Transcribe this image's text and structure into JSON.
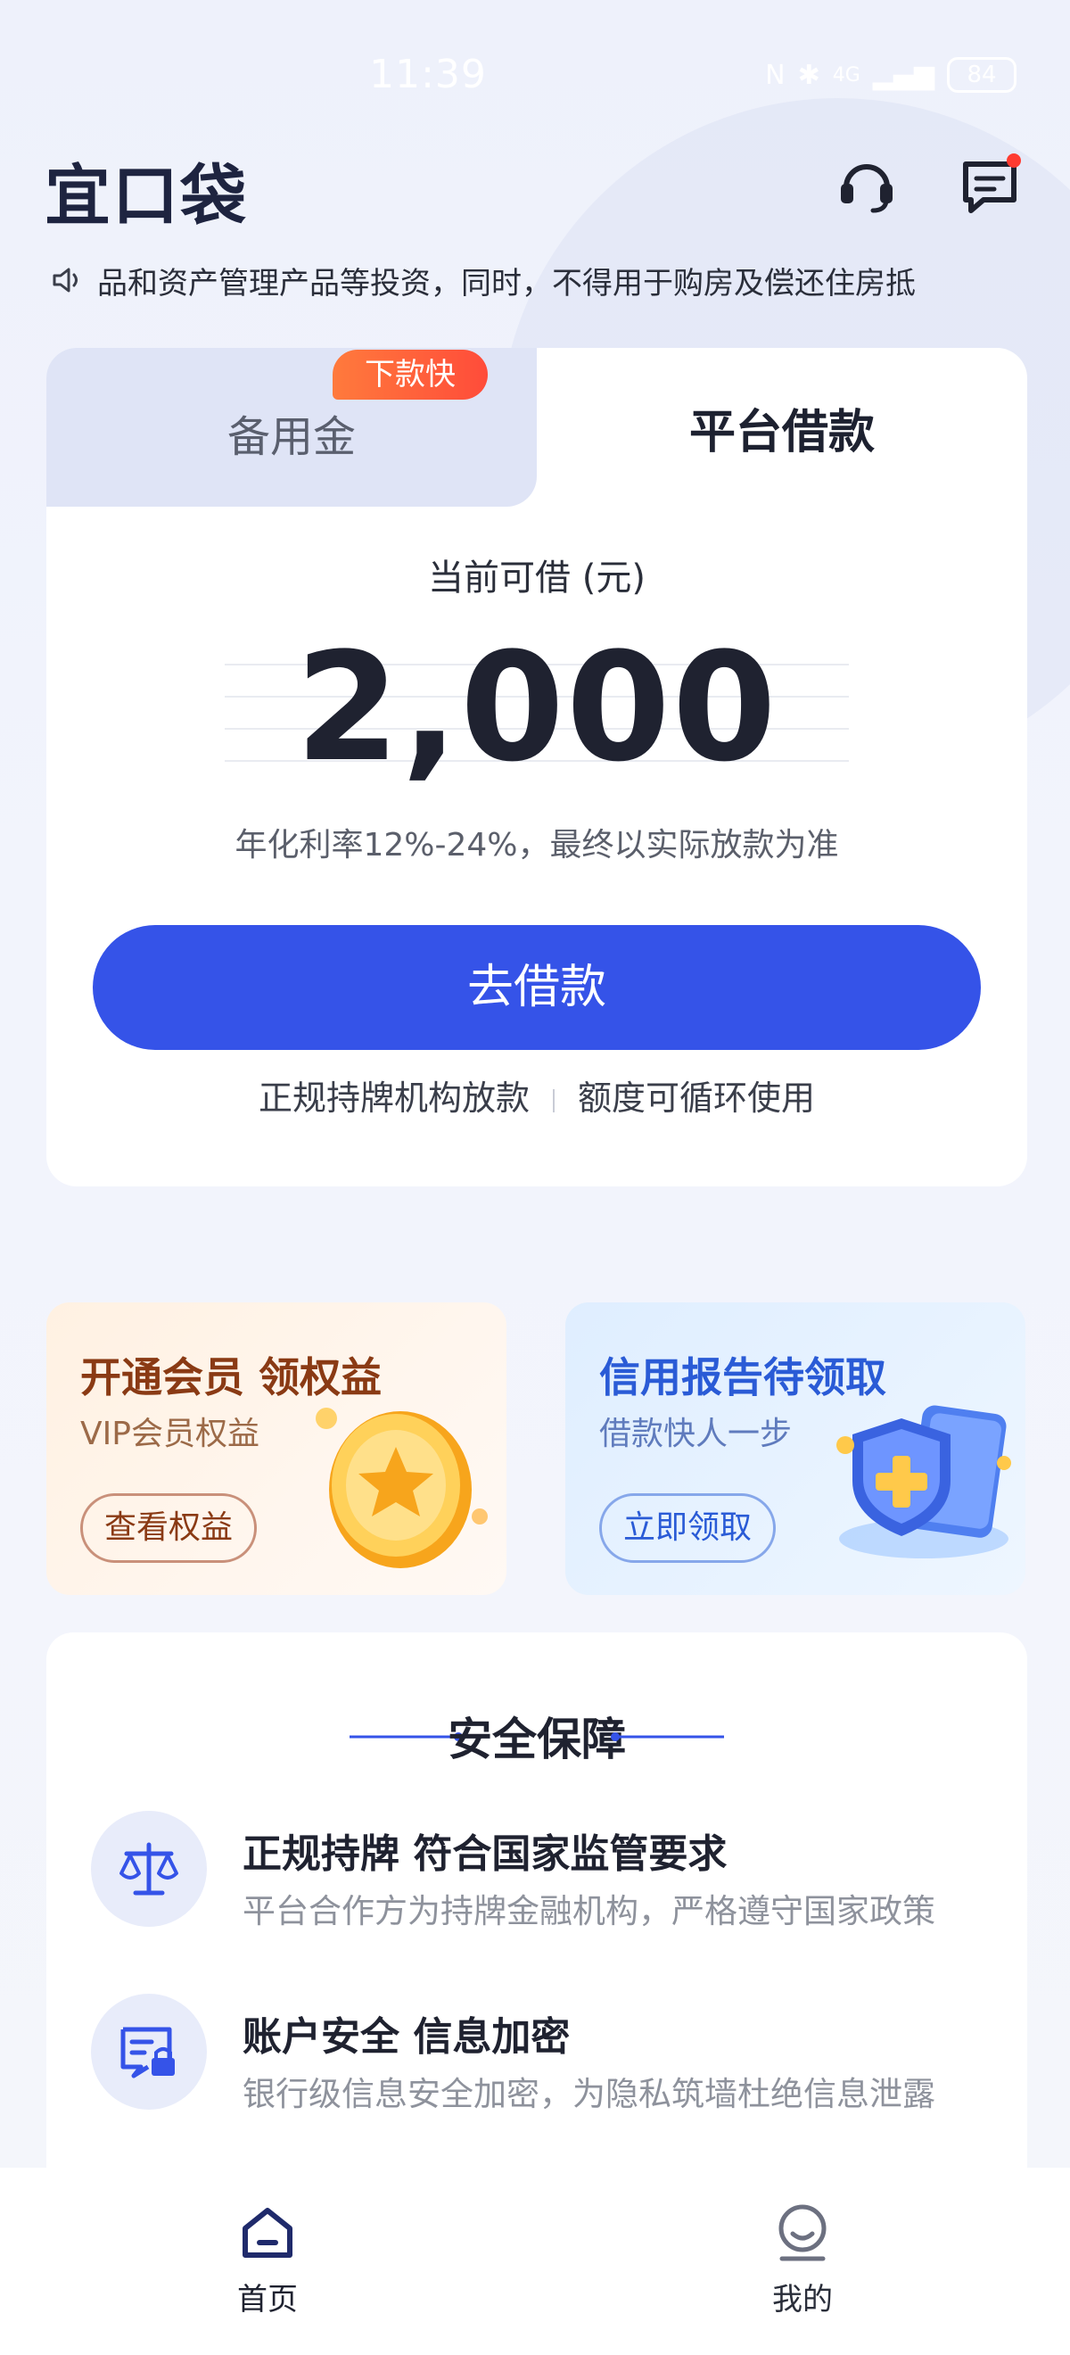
{
  "status_bar": {
    "time": "11:39",
    "network": "4G",
    "battery": "84"
  },
  "header": {
    "logo": "宜口袋",
    "support_icon": "headset-icon",
    "message_icon": "message-icon"
  },
  "notice": {
    "icon": "speaker-icon",
    "text": "品和资产管理产品等投资，同时，不得用于购房及偿还住房抵"
  },
  "loan_card": {
    "tabs": [
      {
        "label": "备用金",
        "badge": "下款快",
        "active": false
      },
      {
        "label": "平台借款",
        "active": true
      }
    ],
    "available_label": "当前可借 (元)",
    "amount": "2,000",
    "rate_note": "年化利率12%-24%，最终以实际放款为准",
    "button_label": "去借款",
    "features": [
      "正规持牌机构放款",
      "额度可循环使用"
    ]
  },
  "promos": [
    {
      "title": "开通会员  领权益",
      "subtitle": "VIP会员权益",
      "button": "查看权益",
      "icon": "star-coin-icon"
    },
    {
      "title": "信用报告待领取",
      "subtitle": "借款快人一步",
      "button": "立即领取",
      "icon": "shield-icon"
    }
  ],
  "security": {
    "title": "安全保障",
    "items": [
      {
        "icon": "scale-icon",
        "title": "正规持牌  符合国家监管要求",
        "desc": "平台合作方为持牌金融机构，严格遵守国家政策"
      },
      {
        "icon": "id-card-lock-icon",
        "title": "账户安全  信息加密",
        "desc": "银行级信息安全加密，为隐私筑墙杜绝信息泄露"
      }
    ]
  },
  "bottom_nav": [
    {
      "label": "首页",
      "icon": "home-icon",
      "active": true
    },
    {
      "label": "我的",
      "icon": "profile-icon",
      "active": false
    }
  ],
  "colors": {
    "primary": "#3553e8",
    "badge": "#ff5a3a",
    "text_dark": "#1f2230"
  }
}
